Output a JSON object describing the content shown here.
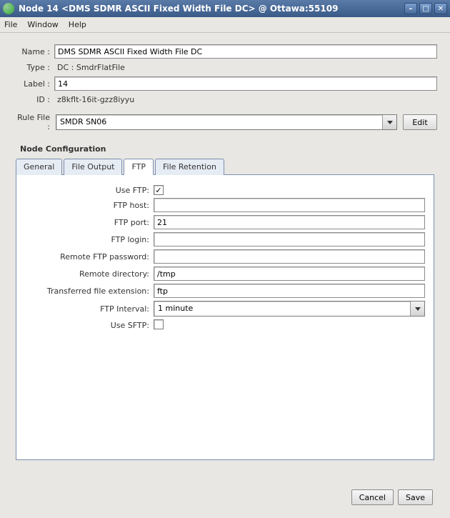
{
  "window": {
    "title": "Node 14 <DMS SDMR ASCII Fixed Width File DC> @ Ottawa:55109"
  },
  "menu": {
    "file": "File",
    "window": "Window",
    "help": "Help"
  },
  "form": {
    "name_label": "Name :",
    "name_value": "DMS SDMR ASCII Fixed Width File DC",
    "type_label": "Type :",
    "type_value": "DC : SmdrFlatFile",
    "label_label": "Label :",
    "label_value": "14",
    "id_label": "ID :",
    "id_value": "z8kflt-16it-gzz8iyyu",
    "rulefile_label": "Rule File :",
    "rulefile_value": "SMDR SN06",
    "edit_label": "Edit"
  },
  "section": {
    "title": "Node Configuration"
  },
  "tabs": {
    "general": "General",
    "fileoutput": "File Output",
    "ftp": "FTP",
    "fileretention": "File Retention"
  },
  "ftp": {
    "use_ftp_label": "Use FTP:",
    "use_ftp_checked": true,
    "host_label": "FTP host:",
    "host_value": "",
    "port_label": "FTP port:",
    "port_value": "21",
    "login_label": "FTP login:",
    "login_value": "",
    "password_label": "Remote FTP password:",
    "password_value": "",
    "remotedir_label": "Remote directory:",
    "remotedir_value": "/tmp",
    "ext_label": "Transferred file extension:",
    "ext_value": "ftp",
    "interval_label": "FTP Interval:",
    "interval_value": "1 minute",
    "use_sftp_label": "Use SFTP:",
    "use_sftp_checked": false
  },
  "footer": {
    "cancel": "Cancel",
    "save": "Save"
  }
}
